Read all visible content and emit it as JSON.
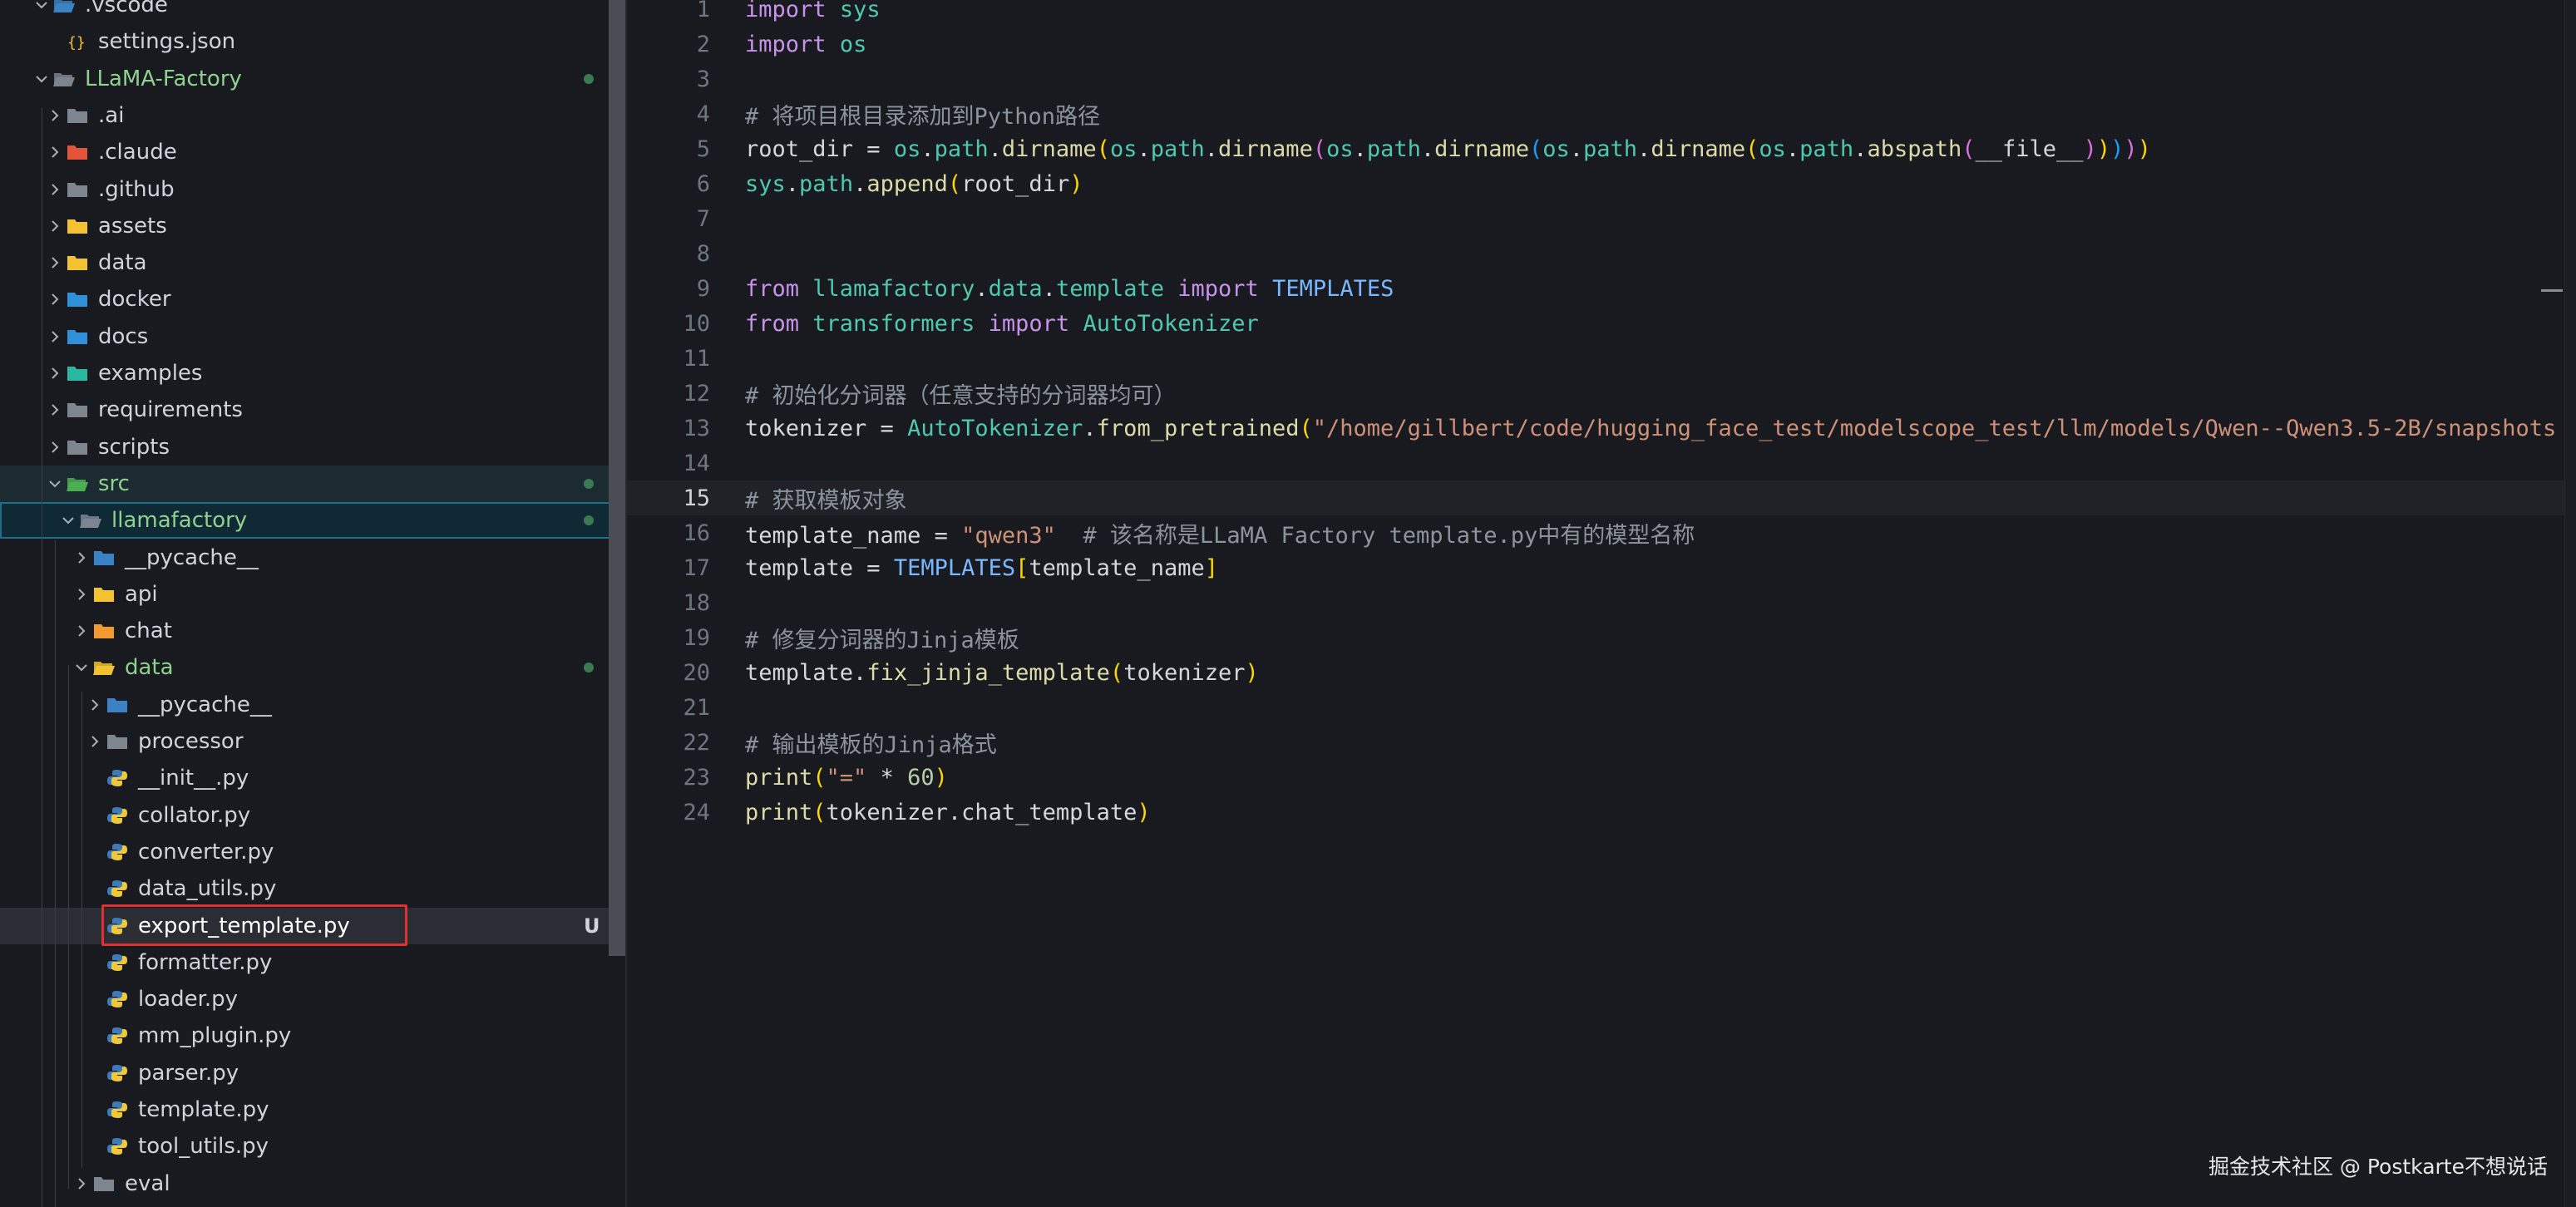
{
  "explorer": {
    "items": [
      {
        "name": "vscode-folder",
        "label": ".vscode",
        "depth": 0,
        "type": "folder-open",
        "icon": "vscode-folder-icon",
        "chev": "down"
      },
      {
        "name": "settings-json",
        "label": "settings.json",
        "depth": 1,
        "type": "file",
        "icon": "json-icon"
      },
      {
        "name": "llama-factory-folder",
        "label": "LLaMA-Factory",
        "depth": 0,
        "type": "folder-open",
        "icon": "folder-open-icon",
        "chev": "down",
        "green": true,
        "dot": true
      },
      {
        "name": "ai-folder",
        "label": ".ai",
        "depth": 1,
        "type": "folder",
        "icon": "folder-icon",
        "chev": "right"
      },
      {
        "name": "claude-folder",
        "label": ".claude",
        "depth": 1,
        "type": "folder",
        "icon": "claude-folder-icon",
        "chev": "right"
      },
      {
        "name": "github-folder",
        "label": ".github",
        "depth": 1,
        "type": "folder",
        "icon": "github-folder-icon",
        "chev": "right"
      },
      {
        "name": "assets-folder",
        "label": "assets",
        "depth": 1,
        "type": "folder",
        "icon": "assets-folder-icon",
        "chev": "right"
      },
      {
        "name": "data-folder-root",
        "label": "data",
        "depth": 1,
        "type": "folder",
        "icon": "data-folder-icon",
        "chev": "right"
      },
      {
        "name": "docker-folder",
        "label": "docker",
        "depth": 1,
        "type": "folder",
        "icon": "docker-folder-icon",
        "chev": "right"
      },
      {
        "name": "docs-folder",
        "label": "docs",
        "depth": 1,
        "type": "folder",
        "icon": "docs-folder-icon",
        "chev": "right"
      },
      {
        "name": "examples-folder",
        "label": "examples",
        "depth": 1,
        "type": "folder",
        "icon": "examples-folder-icon",
        "chev": "right"
      },
      {
        "name": "requirements-folder",
        "label": "requirements",
        "depth": 1,
        "type": "folder",
        "icon": "folder-icon",
        "chev": "right"
      },
      {
        "name": "scripts-folder",
        "label": "scripts",
        "depth": 1,
        "type": "folder",
        "icon": "scripts-folder-icon",
        "chev": "right"
      },
      {
        "name": "src-folder",
        "label": "src",
        "depth": 1,
        "type": "folder-open",
        "icon": "src-folder-icon",
        "chev": "down",
        "green": true,
        "dot": true,
        "state": "active-folder"
      },
      {
        "name": "llamafactory-folder",
        "label": "llamafactory",
        "depth": 2,
        "type": "folder-open",
        "icon": "folder-open-icon",
        "chev": "down",
        "green": true,
        "dot": true,
        "state": "selected"
      },
      {
        "name": "pycache-folder-1",
        "label": "__pycache__",
        "depth": 3,
        "type": "folder",
        "icon": "pycache-folder-icon",
        "chev": "right"
      },
      {
        "name": "api-folder",
        "label": "api",
        "depth": 3,
        "type": "folder",
        "icon": "api-folder-icon",
        "chev": "right"
      },
      {
        "name": "chat-folder",
        "label": "chat",
        "depth": 3,
        "type": "folder",
        "icon": "chat-folder-icon",
        "chev": "right"
      },
      {
        "name": "data-folder",
        "label": "data",
        "depth": 3,
        "type": "folder-open",
        "icon": "data-folder-open-icon",
        "chev": "down",
        "green": true,
        "dot": true
      },
      {
        "name": "pycache-folder-2",
        "label": "__pycache__",
        "depth": 4,
        "type": "folder",
        "icon": "pycache-folder-icon",
        "chev": "right"
      },
      {
        "name": "processor-folder",
        "label": "processor",
        "depth": 4,
        "type": "folder",
        "icon": "folder-icon",
        "chev": "right"
      },
      {
        "name": "init-py",
        "label": "__init__.py",
        "depth": 4,
        "type": "file",
        "icon": "python-icon"
      },
      {
        "name": "collator-py",
        "label": "collator.py",
        "depth": 4,
        "type": "file",
        "icon": "python-icon"
      },
      {
        "name": "converter-py",
        "label": "converter.py",
        "depth": 4,
        "type": "file",
        "icon": "python-icon"
      },
      {
        "name": "data-utils-py",
        "label": "data_utils.py",
        "depth": 4,
        "type": "file",
        "icon": "python-icon"
      },
      {
        "name": "export-template-py",
        "label": "export_template.py",
        "depth": 4,
        "type": "file",
        "icon": "python-icon",
        "state": "active",
        "badge": "U",
        "bold": true
      },
      {
        "name": "formatter-py",
        "label": "formatter.py",
        "depth": 4,
        "type": "file",
        "icon": "python-icon"
      },
      {
        "name": "loader-py",
        "label": "loader.py",
        "depth": 4,
        "type": "file",
        "icon": "python-icon"
      },
      {
        "name": "mm-plugin-py",
        "label": "mm_plugin.py",
        "depth": 4,
        "type": "file",
        "icon": "python-icon"
      },
      {
        "name": "parser-py",
        "label": "parser.py",
        "depth": 4,
        "type": "file",
        "icon": "python-icon"
      },
      {
        "name": "template-py",
        "label": "template.py",
        "depth": 4,
        "type": "file",
        "icon": "python-icon"
      },
      {
        "name": "tool-utils-py",
        "label": "tool_utils.py",
        "depth": 4,
        "type": "file",
        "icon": "python-icon"
      },
      {
        "name": "eval-folder",
        "label": "eval",
        "depth": 3,
        "type": "folder",
        "icon": "folder-icon",
        "chev": "right"
      }
    ]
  },
  "editor": {
    "current_line": 15,
    "lines": [
      {
        "n": "1",
        "tokens": [
          [
            "kw",
            "import"
          ],
          [
            "var",
            " "
          ],
          [
            "mod",
            "sys"
          ]
        ]
      },
      {
        "n": "2",
        "tokens": [
          [
            "kw",
            "import"
          ],
          [
            "var",
            " "
          ],
          [
            "mod",
            "os"
          ]
        ]
      },
      {
        "n": "3",
        "tokens": []
      },
      {
        "n": "4",
        "tokens": [
          [
            "cm",
            "# 将项目根目录添加到Python路径"
          ]
        ]
      },
      {
        "n": "5",
        "tokens": [
          [
            "var",
            "root_dir = "
          ],
          [
            "mod",
            "os"
          ],
          [
            "var",
            "."
          ],
          [
            "mod",
            "path"
          ],
          [
            "var",
            "."
          ],
          [
            "fn",
            "dirname"
          ],
          [
            "b1",
            "("
          ],
          [
            "mod",
            "os"
          ],
          [
            "var",
            "."
          ],
          [
            "mod",
            "path"
          ],
          [
            "var",
            "."
          ],
          [
            "fn",
            "dirname"
          ],
          [
            "b2",
            "("
          ],
          [
            "mod",
            "os"
          ],
          [
            "var",
            "."
          ],
          [
            "mod",
            "path"
          ],
          [
            "var",
            "."
          ],
          [
            "fn",
            "dirname"
          ],
          [
            "b3",
            "("
          ],
          [
            "mod",
            "os"
          ],
          [
            "var",
            "."
          ],
          [
            "mod",
            "path"
          ],
          [
            "var",
            "."
          ],
          [
            "fn",
            "dirname"
          ],
          [
            "b1",
            "("
          ],
          [
            "mod",
            "os"
          ],
          [
            "var",
            "."
          ],
          [
            "mod",
            "path"
          ],
          [
            "var",
            "."
          ],
          [
            "fn",
            "abspath"
          ],
          [
            "b2",
            "("
          ],
          [
            "dun",
            "__file__"
          ],
          [
            "b2",
            ")"
          ],
          [
            "b1",
            ")"
          ],
          [
            "b3",
            ")"
          ],
          [
            "b2",
            ")"
          ],
          [
            "b1",
            ")"
          ]
        ]
      },
      {
        "n": "6",
        "tokens": [
          [
            "mod",
            "sys"
          ],
          [
            "var",
            "."
          ],
          [
            "mod",
            "path"
          ],
          [
            "var",
            "."
          ],
          [
            "fn",
            "append"
          ],
          [
            "b1",
            "("
          ],
          [
            "var",
            "root_dir"
          ],
          [
            "b1",
            ")"
          ]
        ]
      },
      {
        "n": "7",
        "tokens": []
      },
      {
        "n": "8",
        "tokens": []
      },
      {
        "n": "9",
        "tokens": [
          [
            "kw",
            "from"
          ],
          [
            "var",
            " "
          ],
          [
            "mod",
            "llamafactory"
          ],
          [
            "var",
            "."
          ],
          [
            "mod",
            "data"
          ],
          [
            "var",
            "."
          ],
          [
            "mod",
            "template"
          ],
          [
            "var",
            " "
          ],
          [
            "kw",
            "import"
          ],
          [
            "var",
            " "
          ],
          [
            "con",
            "TEMPLATES"
          ]
        ]
      },
      {
        "n": "10",
        "tokens": [
          [
            "kw",
            "from"
          ],
          [
            "var",
            " "
          ],
          [
            "mod",
            "transformers"
          ],
          [
            "var",
            " "
          ],
          [
            "kw",
            "import"
          ],
          [
            "var",
            " "
          ],
          [
            "cls",
            "AutoTokenizer"
          ]
        ]
      },
      {
        "n": "11",
        "tokens": []
      },
      {
        "n": "12",
        "tokens": [
          [
            "cm",
            "# 初始化分词器（任意支持的分词器均可）"
          ]
        ]
      },
      {
        "n": "13",
        "tokens": [
          [
            "var",
            "tokenizer = "
          ],
          [
            "cls",
            "AutoTokenizer"
          ],
          [
            "var",
            "."
          ],
          [
            "fn",
            "from_pretrained"
          ],
          [
            "b1",
            "("
          ],
          [
            "str",
            "\"/home/gillbert/code/hugging_face_test/modelscope_test/llm/models/Qwen--Qwen3.5-2B/snapshots"
          ]
        ]
      },
      {
        "n": "14",
        "tokens": []
      },
      {
        "n": "15",
        "tokens": [
          [
            "cm",
            "# 获取模板对象"
          ]
        ]
      },
      {
        "n": "16",
        "tokens": [
          [
            "var",
            "template_name = "
          ],
          [
            "str",
            "\"qwen3\""
          ],
          [
            "var",
            "  "
          ],
          [
            "cm",
            "# 该名称是LLaMA Factory template.py中有的模型名称"
          ]
        ]
      },
      {
        "n": "17",
        "tokens": [
          [
            "var",
            "template = "
          ],
          [
            "con",
            "TEMPLATES"
          ],
          [
            "b1",
            "["
          ],
          [
            "var",
            "template_name"
          ],
          [
            "b1",
            "]"
          ]
        ]
      },
      {
        "n": "18",
        "tokens": []
      },
      {
        "n": "19",
        "tokens": [
          [
            "cm",
            "# 修复分词器的Jinja模板"
          ]
        ]
      },
      {
        "n": "20",
        "tokens": [
          [
            "var",
            "template."
          ],
          [
            "fn",
            "fix_jinja_template"
          ],
          [
            "b1",
            "("
          ],
          [
            "var",
            "tokenizer"
          ],
          [
            "b1",
            ")"
          ]
        ]
      },
      {
        "n": "21",
        "tokens": []
      },
      {
        "n": "22",
        "tokens": [
          [
            "cm",
            "# 输出模板的Jinja格式"
          ]
        ]
      },
      {
        "n": "23",
        "tokens": [
          [
            "fn",
            "print"
          ],
          [
            "b1",
            "("
          ],
          [
            "str",
            "\"=\""
          ],
          [
            "var",
            " * "
          ],
          [
            "num",
            "60"
          ],
          [
            "b1",
            ")"
          ]
        ]
      },
      {
        "n": "24",
        "tokens": [
          [
            "fn",
            "print"
          ],
          [
            "b1",
            "("
          ],
          [
            "var",
            "tokenizer.chat_template"
          ],
          [
            "b1",
            ")"
          ]
        ]
      }
    ]
  },
  "watermark": "掘金技术社区 @ Postkarte不想说话"
}
